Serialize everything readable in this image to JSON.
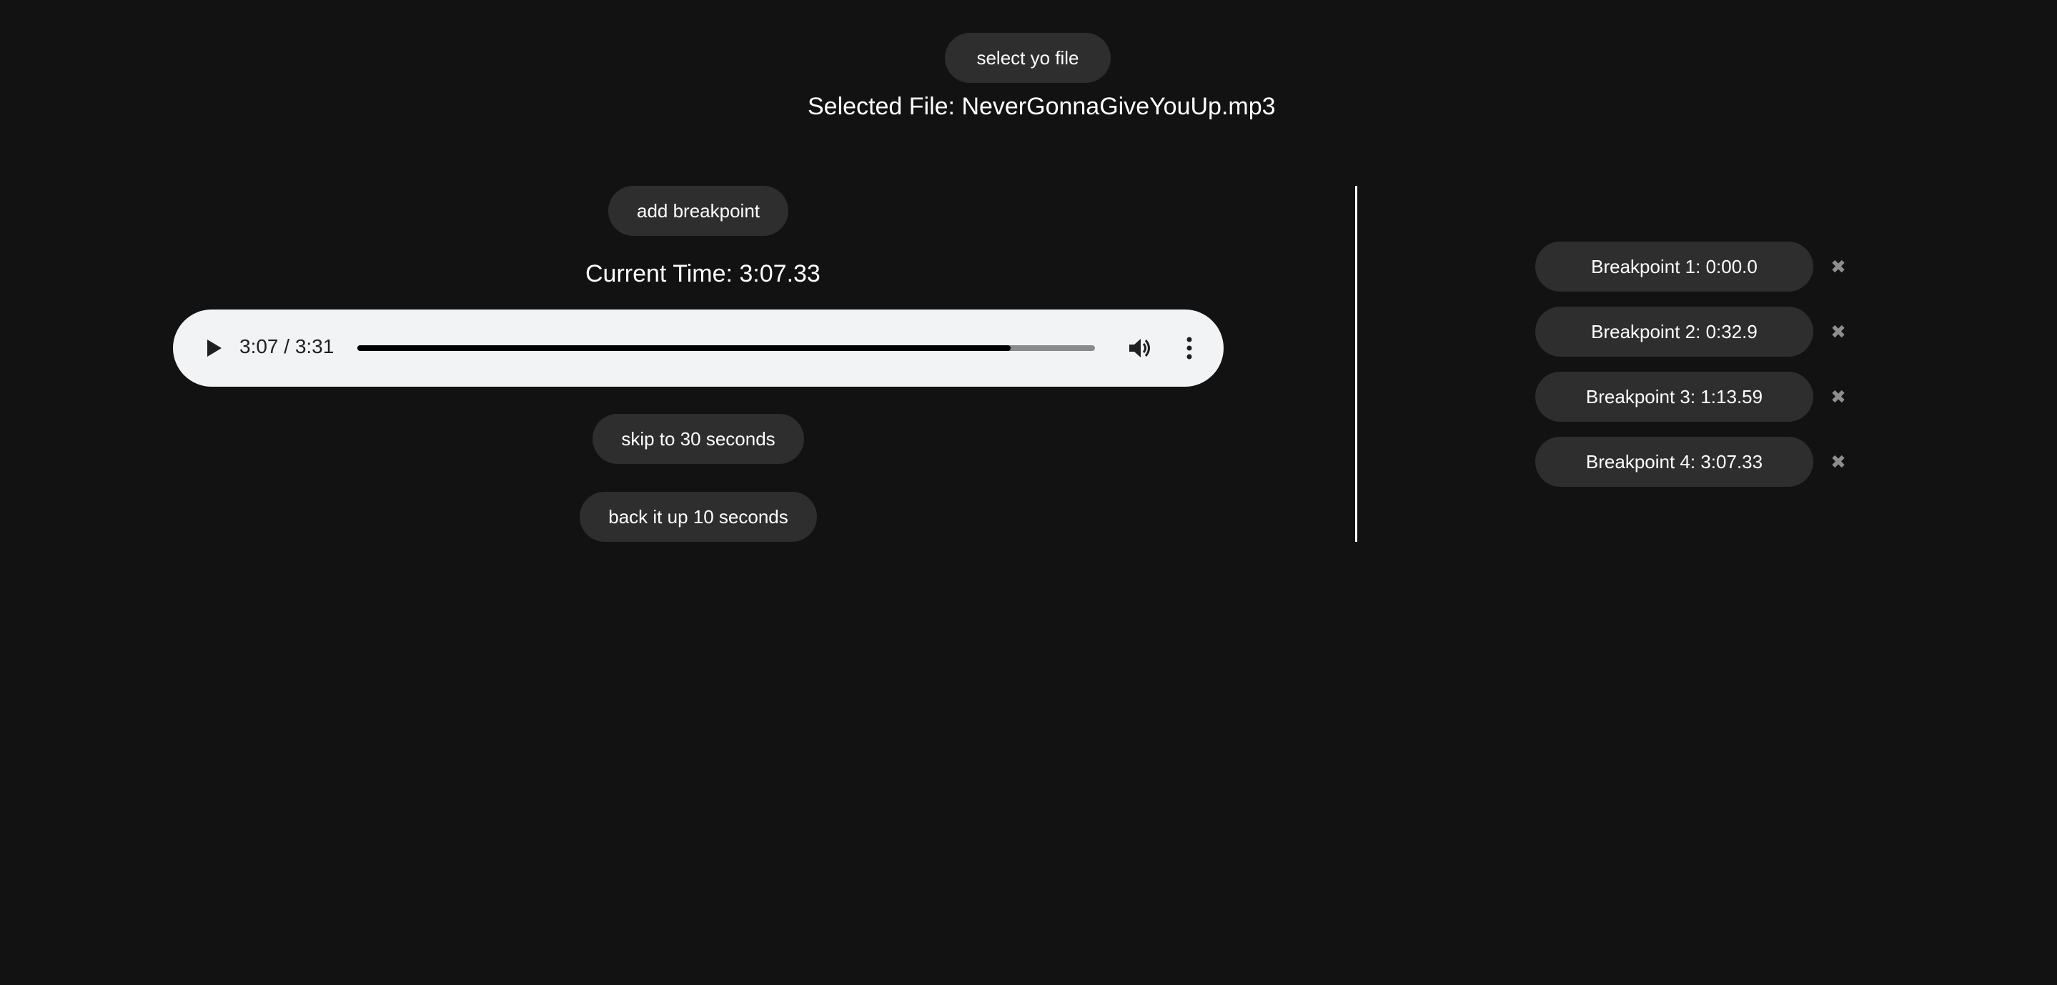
{
  "file": {
    "select_button_label": "select yo file",
    "selected_text": "Selected File: NeverGonnaGiveYouUp.mp3"
  },
  "controls": {
    "add_breakpoint_label": "add breakpoint",
    "current_time_text": "Current Time: 3:07.33",
    "skip_label": "skip to 30 seconds",
    "back_label": "back it up 10 seconds"
  },
  "player": {
    "time_display": "3:07 / 3:31",
    "progress": 0.886,
    "play_icon": "play-icon",
    "volume_icon": "volume-icon",
    "more_icon": "more-options-icon"
  },
  "breakpoints": [
    {
      "label": "Breakpoint 1: 0:00.0"
    },
    {
      "label": "Breakpoint 2: 0:32.9"
    },
    {
      "label": "Breakpoint 3: 1:13.59"
    },
    {
      "label": "Breakpoint 4: 3:07.33"
    }
  ],
  "delete_icon": "✖",
  "colors": {
    "background": "#121212",
    "button": "#2e2e2e",
    "player": "#f1f3f4",
    "text": "#ffffff",
    "delete": "#8e8e8e"
  }
}
